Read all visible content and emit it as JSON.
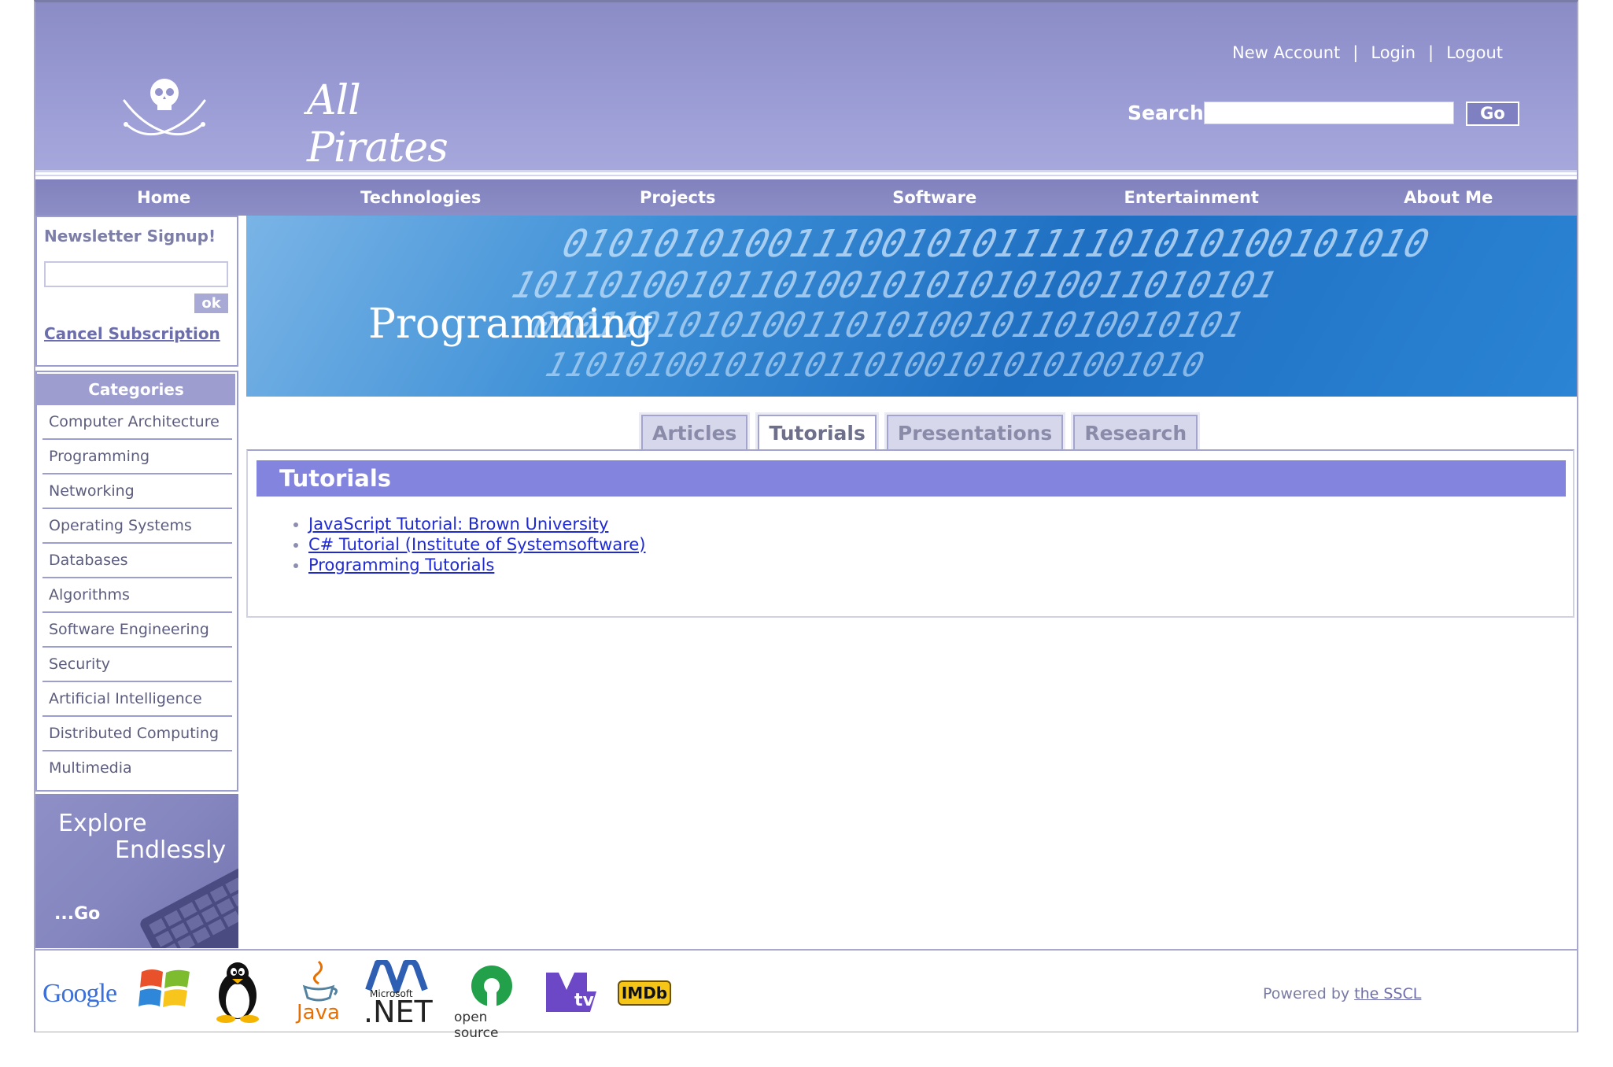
{
  "site": {
    "logo_text": "All Pirates"
  },
  "account": {
    "new_account": "New Account",
    "separator": "|",
    "login": "Login",
    "logout": "Logout"
  },
  "search": {
    "label": "Search:",
    "value": "",
    "go_label": "Go"
  },
  "nav": {
    "items": [
      "Home",
      "Technologies",
      "Projects",
      "Software",
      "Entertainment",
      "About Me"
    ]
  },
  "newsletter": {
    "title": "Newsletter Signup!",
    "value": "",
    "ok_label": "ok",
    "cancel_label": "Cancel Subscription"
  },
  "categories": {
    "title": "Categories",
    "items": [
      "Computer Architecture",
      "Programming",
      "Networking",
      "Operating Systems",
      "Databases",
      "Algorithms",
      "Software Engineering",
      "Security",
      "Artificial Intelligence",
      "Distributed Computing",
      "Multimedia"
    ]
  },
  "promo": {
    "line1": "Explore",
    "line2": "Endlessly",
    "go": "...Go"
  },
  "banner": {
    "title": "Programming"
  },
  "tabs": {
    "items": [
      "Articles",
      "Tutorials",
      "Presentations",
      "Research"
    ],
    "active": "Tutorials"
  },
  "content": {
    "heading": "Tutorials",
    "links": [
      "JavaScript Tutorial: Brown University",
      "C# Tutorial (Institute of Systemsoftware)",
      "Programming Tutorials"
    ]
  },
  "footer": {
    "logos": [
      "Google",
      "Windows",
      "Linux",
      "Java",
      "Microsoft .NET",
      "open source",
      "MTV",
      "IMDb"
    ],
    "google_text": "Google",
    "java_text": "Java",
    "net_small": "Microsoft",
    "net_text": ".NET",
    "opensource_text": "open source",
    "imdb_text": "IMDb",
    "powered_prefix": "Powered by",
    "powered_link": "the SSCL"
  },
  "colors": {
    "header": "#9a9bd4",
    "nav": "#8687c2",
    "accent": "#8384dd",
    "link": "#1f2ad1"
  },
  "icons": {
    "logo": "jolly-roger-icon",
    "keyboard": "keyboard-icon"
  }
}
